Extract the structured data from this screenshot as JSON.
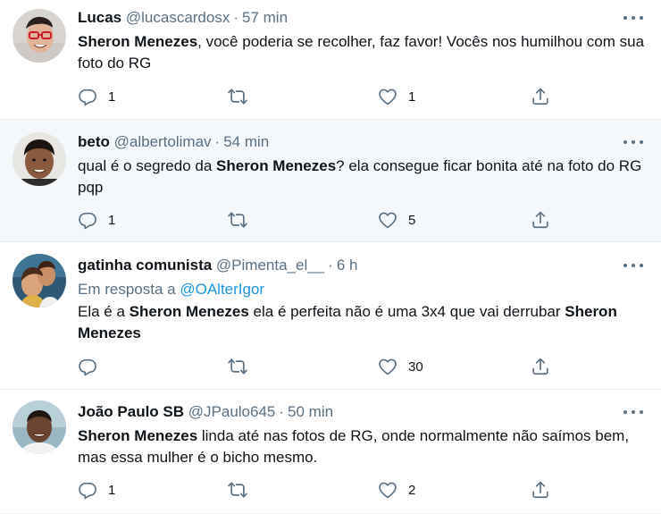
{
  "tweets": [
    {
      "name": "Lucas",
      "handle": "@lucascardosx",
      "time": "57 min",
      "body_parts": [
        "Sheron Menezes",
        ", você poderia se recolher, faz favor! Vocês nos humilhou com sua foto do RG"
      ],
      "replies": "1",
      "retweets": "",
      "likes": "1"
    },
    {
      "name": "beto",
      "handle": "@albertolimav",
      "time": "54 min",
      "body_parts": [
        "qual é o segredo da ",
        "Sheron Menezes",
        "? ela consegue ficar bonita até na foto do RG pqp"
      ],
      "replies": "1",
      "retweets": "",
      "likes": "5"
    },
    {
      "name": "gatinha comunista",
      "handle": "@Pimenta_el__",
      "time": "6 h",
      "reply_prefix": "Em resposta a",
      "reply_mention": "@OAlterIgor",
      "body_parts": [
        "Ela é a ",
        "Sheron Menezes",
        " ela é perfeita não é uma 3x4 que vai derrubar ",
        "Sheron Menezes"
      ],
      "replies": "",
      "retweets": "",
      "likes": "30"
    },
    {
      "name": "João Paulo SB",
      "handle": "@JPaulo645",
      "time": "50 min",
      "body_parts": [
        "Sheron Menezes",
        " linda até nas fotos de RG, onde normalmente não saímos bem, mas essa mulher é o bicho mesmo."
      ],
      "replies": "1",
      "retweets": "",
      "likes": "2"
    }
  ],
  "separator": "·",
  "colors": {
    "text": "#0f1419",
    "secondary": "#5b7083",
    "link": "#1b95e0",
    "highlight_bg": "#f5f8fa",
    "divider": "#e6ecf0"
  },
  "icons": [
    "reply-icon",
    "retweet-icon",
    "like-icon",
    "share-icon",
    "more-icon"
  ]
}
